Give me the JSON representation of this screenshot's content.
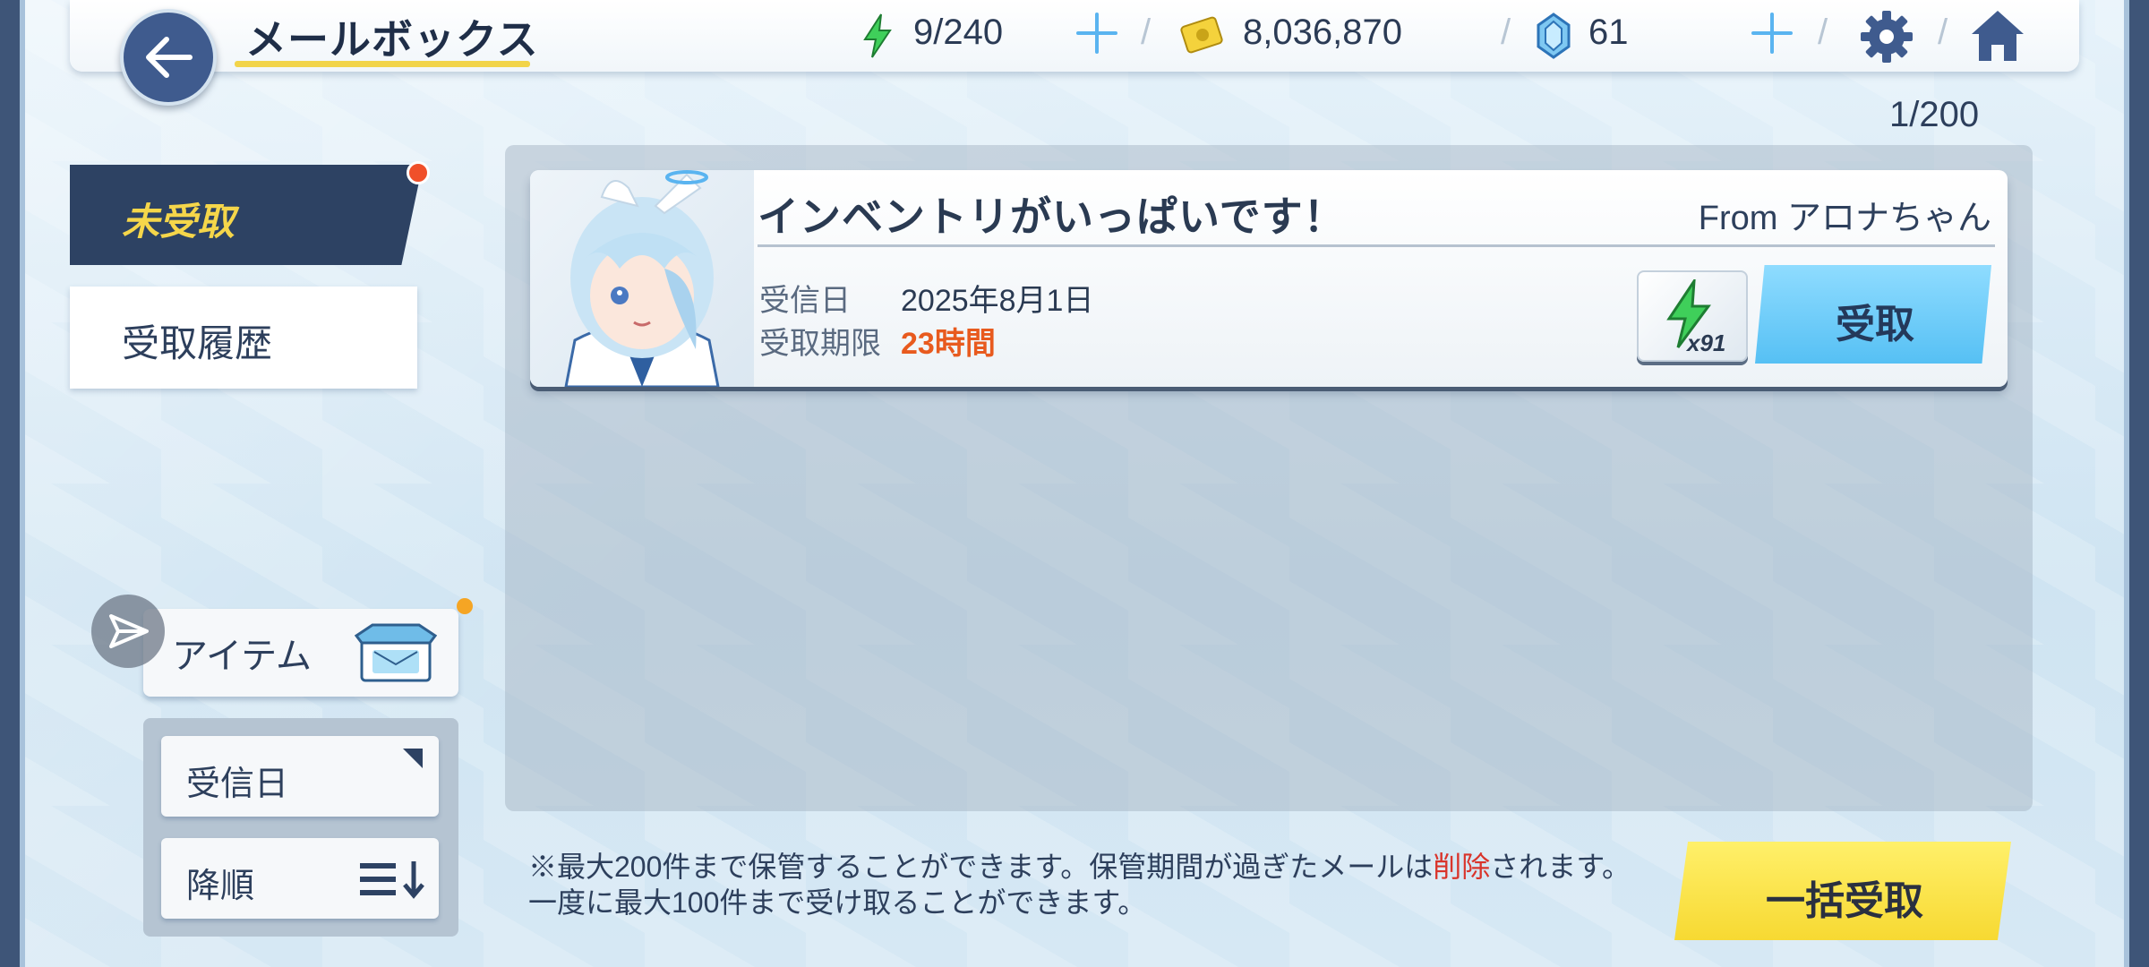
{
  "header": {
    "title": "メールボックス",
    "stamina": "9/240",
    "credits": "8,036,870",
    "gems": "61"
  },
  "sidebar": {
    "tabs": [
      {
        "label": "未受取",
        "active": true,
        "has_notification": true
      },
      {
        "label": "受取履歴",
        "active": false
      }
    ],
    "filter": {
      "label": "アイテム",
      "icon": "mail-box-icon"
    },
    "sort": {
      "field": "受信日",
      "order": "降順"
    }
  },
  "mailbox": {
    "count": "1/200",
    "mails": [
      {
        "title": "インベントリがいっぱいです！",
        "from": "From アロナちゃん",
        "received_label": "受信日",
        "received_date": "2025年8月1日",
        "expiry_label": "受取期限",
        "expiry": "23時間",
        "reward_icon": "stamina-bolt-icon",
        "reward_qty": "x91",
        "action_label": "受取"
      }
    ]
  },
  "footer": {
    "note_part1": "※最大200件まで保管することができます。保管期間が過ぎたメールは",
    "note_highlight": "削除",
    "note_part2": "されます。一度に最大100件まで受け取ることができます。",
    "claim_all_label": "一括受取"
  },
  "colors": {
    "accent_blue": "#56c0f4",
    "accent_yellow": "#f7d932",
    "navy": "#2d4263",
    "warning": "#e85a1e"
  }
}
